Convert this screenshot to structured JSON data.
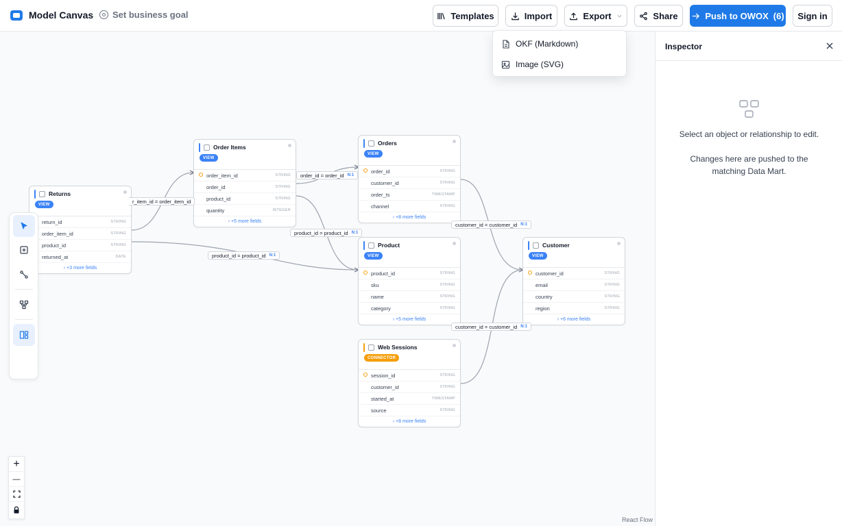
{
  "header": {
    "app_title": "Model Canvas",
    "goal_label": "Set business goal",
    "templates_label": "Templates",
    "import_label": "Import",
    "export_label": "Export",
    "share_label": "Share",
    "push_label": "Push to OWOX",
    "push_count": "(6)",
    "signin_label": "Sign in",
    "accent_color": "#1f7ae8"
  },
  "export_menu": {
    "items": [
      {
        "label": "OKF (Markdown)",
        "icon": "file-text-icon"
      },
      {
        "label": "Image (SVG)",
        "icon": "image-icon"
      }
    ]
  },
  "nodes": {
    "returns": {
      "title": "Returns",
      "badge": "VIEW",
      "fields": [
        {
          "name": "return_id",
          "type": "STRING"
        },
        {
          "name": "order_item_id",
          "type": "STRING"
        },
        {
          "name": "product_id",
          "type": "STRING"
        },
        {
          "name": "returned_at",
          "type": "DATE"
        }
      ],
      "more": "+3 more fields"
    },
    "order_items": {
      "title": "Order Items",
      "badge": "VIEW",
      "fields": [
        {
          "name": "order_item_id",
          "type": "STRING"
        },
        {
          "name": "order_id",
          "type": "STRING"
        },
        {
          "name": "product_id",
          "type": "STRING"
        },
        {
          "name": "quantity",
          "type": "INTEGER"
        }
      ],
      "more": "+5 more fields"
    },
    "orders": {
      "title": "Orders",
      "badge": "VIEW",
      "fields": [
        {
          "name": "order_id",
          "type": "STRING"
        },
        {
          "name": "customer_id",
          "type": "STRING"
        },
        {
          "name": "order_ts",
          "type": "TIMESTAMP"
        },
        {
          "name": "channel",
          "type": "STRING"
        }
      ],
      "more": "+8 more fields"
    },
    "product": {
      "title": "Product",
      "badge": "VIEW",
      "fields": [
        {
          "name": "product_id",
          "type": "STRING"
        },
        {
          "name": "sku",
          "type": "STRING"
        },
        {
          "name": "name",
          "type": "STRING"
        },
        {
          "name": "category",
          "type": "STRING"
        }
      ],
      "more": "+5 more fields"
    },
    "customer": {
      "title": "Customer",
      "badge": "VIEW",
      "fields": [
        {
          "name": "customer_id",
          "type": "STRING"
        },
        {
          "name": "email",
          "type": "STRING"
        },
        {
          "name": "country",
          "type": "STRING"
        },
        {
          "name": "region",
          "type": "STRING"
        }
      ],
      "more": "+6 more fields"
    },
    "web_sessions": {
      "title": "Web Sessions",
      "badge": "CONNECTOR",
      "fields": [
        {
          "name": "session_id",
          "type": "STRING"
        },
        {
          "name": "customer_id",
          "type": "STRING"
        },
        {
          "name": "started_at",
          "type": "TIMESTAMP"
        },
        {
          "name": "source",
          "type": "STRING"
        }
      ],
      "more": "+8 more fields"
    }
  },
  "edges": {
    "e1": {
      "label": "r_item_id = order_item_id",
      "card": ""
    },
    "e2": {
      "label": "order_id = order_id",
      "card": "N:1"
    },
    "e3": {
      "label": "product_id = product_id",
      "card": "N:1"
    },
    "e4": {
      "label": "product_id = product_id",
      "card": "N:1"
    },
    "e5": {
      "label": "customer_id = customer_id",
      "card": "N:1"
    },
    "e6": {
      "label": "customer_id = customer_id",
      "card": "N:1"
    }
  },
  "zoom_controls": {
    "zoom_in": "+",
    "zoom_out": "—"
  },
  "attribution": "React Flow",
  "inspector": {
    "title": "Inspector",
    "empty_line1": "Select an object or relationship to edit.",
    "empty_line2": "Changes here are pushed to the matching Data Mart."
  }
}
